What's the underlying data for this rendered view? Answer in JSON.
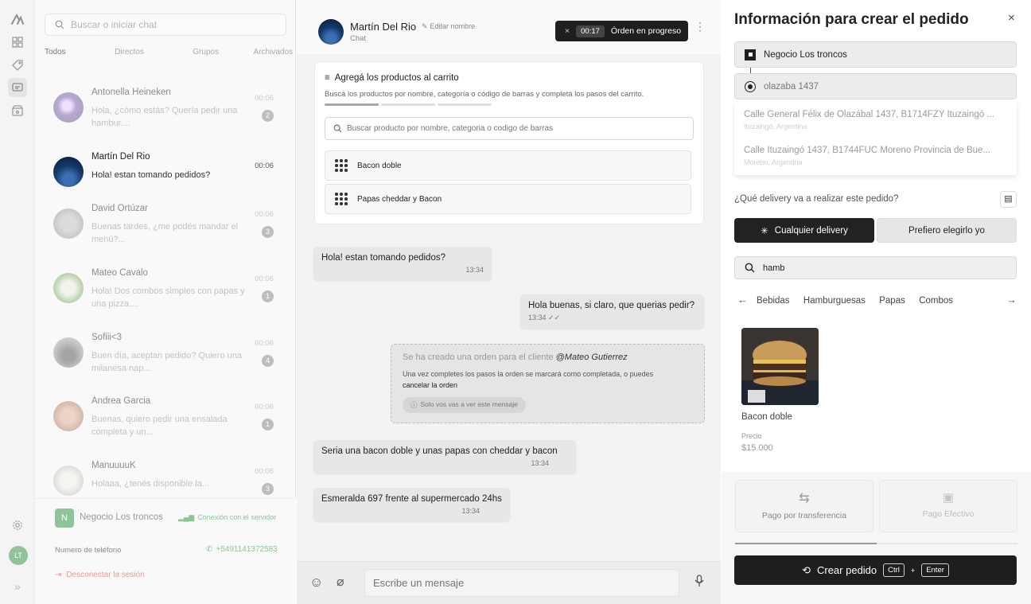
{
  "search": {
    "placeholder": "Buscar o iniciar chat"
  },
  "tabs": [
    "Todos",
    "Directos",
    "Grupos",
    "Archivados"
  ],
  "conversations": [
    {
      "name": "Antonella Heineken",
      "preview": "Hola, ¿cómo estás? Quería pedir una hambur....",
      "time": "00:06",
      "badge": "2"
    },
    {
      "name": "Martín Del Rio",
      "preview": "Hola! estan tomando pedidos?",
      "time": "00:06",
      "badge": ""
    },
    {
      "name": "David Ortúzar",
      "preview": "Buenas tardes, ¿me podés mandar el menú?...",
      "time": "00:06",
      "badge": "3"
    },
    {
      "name": "Mateo Cavalo",
      "preview": "Hola! Dos combos simples con papas y una pizza....",
      "time": "00:06",
      "badge": "1"
    },
    {
      "name": "Sofiii<3",
      "preview": "Buen día, aceptan pedido? Quiero una milanesa nap...",
      "time": "00:06",
      "badge": "4"
    },
    {
      "name": "Andrea Garcia",
      "preview": "Buenas, quiero pedir una ensalada completa y un...",
      "time": "00:06",
      "badge": "1"
    },
    {
      "name": "ManuuuuK",
      "preview": "Holaaa, ¿tenés disponible la...",
      "time": "00:06",
      "badge": "3"
    }
  ],
  "business": {
    "initial": "N",
    "name": "Negocio Los troncos",
    "status": "Conexión con el servidor",
    "phone_label": "Numero de teléfono",
    "phone": "+5491141372583",
    "logout": "Desconectar la sesión"
  },
  "user": {
    "initials": "LT"
  },
  "chat": {
    "contact_name": "Martín Del Rio",
    "edit_label": "Editar nombre",
    "subtitle": "Chat",
    "timer": "00:17",
    "order_status": "Órden en progreso",
    "cart_title": "Agregá los productos al carrito",
    "cart_desc": "Buscá los productos por nombre, categoría o código de barras y completá los pasos del carrito.",
    "cart_progress": 0.33,
    "product_search_placeholder": "Buscar producto por nombre, categoria o codigo de barras",
    "cart_items": [
      "Bacon doble",
      "Papas cheddar y Bacon"
    ],
    "messages": [
      {
        "text": "Hola! estan tomando pedidos?",
        "time": "13:34"
      },
      {
        "text": "Hola buenas, si claro, que querias pedir?",
        "time": "13:34"
      },
      {
        "text": "Seria una bacon doble y unas papas con cheddar y bacon",
        "time": "13:34"
      },
      {
        "text": "Esmeralda 697 frente al supermercado 24hs",
        "time": "13:34"
      }
    ],
    "system": {
      "prefix": "Se ha creado una orden para el cliente ",
      "client": "@Mateo Gutierrez",
      "body": "Una vez completes los pasos la orden se marcará como completada, o puedes",
      "link": "cancelar la orden",
      "note": "Solo vos vas a ver este mensaje"
    },
    "composer_placeholder": "Escribe un mensaje"
  },
  "order": {
    "title": "Información para crear el pedido",
    "business": "Negocio Los troncos",
    "address_input": "olazaba 1437",
    "suggestions": [
      {
        "address": "Calle General Félix de Olazábal 1437, B1714FZY Ituzaingó ...",
        "region": "Ituzaingó, Argentina"
      },
      {
        "address": "Calle Ituzaingó 1437, B1744FUC Moreno Provincia de Bue...",
        "region": "Moreno, Argentina"
      }
    ],
    "delivery_question": "¿Qué delivery va a realizar este pedido?",
    "delivery_any": "Cualquier delivery",
    "delivery_choose": "Prefiero elegirlo yo",
    "search_value": "hamb",
    "categories": [
      "Bebidas",
      "Hamburguesas",
      "Papas",
      "Combos"
    ],
    "product": {
      "name": "Bacon doble",
      "price_label": "Precio",
      "price": "$15.000"
    },
    "payment_transfer": "Pago por transferencia",
    "payment_cash": "Pago Efectivo",
    "create": "Crear pedido",
    "kbd_ctrl": "Ctrl",
    "kbd_plus": "+",
    "kbd_enter": "Enter"
  }
}
